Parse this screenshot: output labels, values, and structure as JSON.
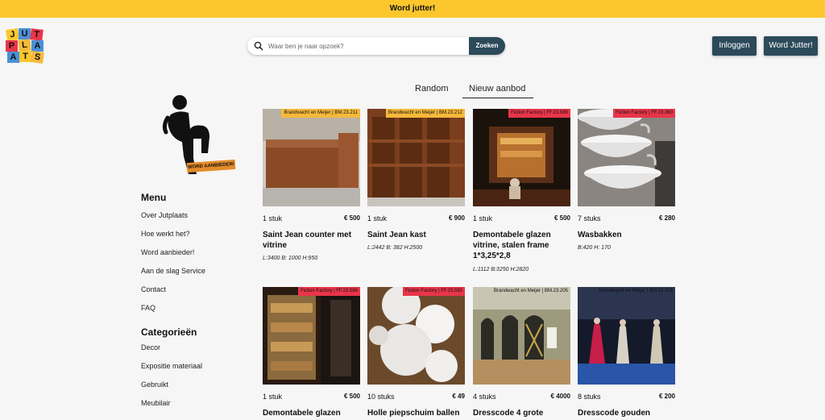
{
  "topbar": {
    "text": "Word jutter!"
  },
  "logo": {
    "letters": [
      "J",
      "U",
      "T",
      "P",
      "L",
      "A",
      "A",
      "T",
      "S"
    ]
  },
  "search": {
    "placeholder": "Waar ben je naar opzoek?",
    "button": "Zoeken"
  },
  "header_buttons": {
    "login": "Inloggen",
    "signup": "Word Jutter!"
  },
  "tabs": {
    "random": "Random",
    "new": "Nieuw aanbod",
    "active": "Nieuw aanbod"
  },
  "badge": {
    "text": "WORD AANBIEDER!"
  },
  "sidebar": {
    "menu_heading": "Menu",
    "menu_items": [
      "Over Jutplaats",
      "Hoe werkt het?",
      "Word aanbieder!",
      "Aan de slag Service",
      "Contact",
      "FAQ"
    ],
    "categories_heading": "Categorieën",
    "category_items": [
      "Decor",
      "Expositie materiaal",
      "Gebruikt",
      "Meubilair"
    ]
  },
  "colors": {
    "accent": "#fcc72c",
    "primary": "#2c4a5a",
    "tag_red": "#e8354a",
    "tag_yellow": "#f6b93b"
  },
  "products": [
    {
      "supplier": "Brandwacht en Meijer",
      "code": "BM.23.211",
      "tag_color": "yellow",
      "qty": "1 stuk",
      "price": "€ 500",
      "title": "Saint Jean counter met vitrine",
      "dims": "L:3400  B: 1000  H:950"
    },
    {
      "supplier": "Brandwacht en Meijer",
      "code": "BM.23.212",
      "tag_color": "yellow",
      "qty": "1 stuk",
      "price": "€ 900",
      "title": "Saint Jean kast",
      "dims": "L:2442  B: 382  H:2500"
    },
    {
      "supplier": "Fiction Factory",
      "code": "FF.23.589",
      "tag_color": "red",
      "qty": "1 stuk",
      "price": "€ 500",
      "title": "Demontabele glazen vitrine, stalen frame 1*3,25*2,8",
      "dims": "L:1112  B:3250  H:2820"
    },
    {
      "supplier": "Fiction Factory",
      "code": "FF.23.360",
      "tag_color": "red",
      "qty": "7 stuks",
      "price": "€ 280",
      "title": "Wasbakken",
      "dims": "B:420  H: 170"
    },
    {
      "supplier": "Fiction Factory",
      "code": "FF.23.588",
      "tag_color": "red",
      "qty": "1 stuk",
      "price": "€ 500",
      "title": "Demontabele glazen",
      "dims": ""
    },
    {
      "supplier": "Fiction Factory",
      "code": "FF.23.592",
      "tag_color": "red",
      "qty": "10 stuks",
      "price": "€ 49",
      "title": "Holle piepschuim ballen",
      "dims": ""
    },
    {
      "supplier": "Brandwacht en Meijer",
      "code": "BM.23.205",
      "tag_color": "none",
      "qty": "4 stuks",
      "price": "€ 4000",
      "title": "Dresscode 4 grote",
      "dims": ""
    },
    {
      "supplier": "Brandwacht en Meijer",
      "code": "BM.23.208",
      "tag_color": "none",
      "qty": "8 stuks",
      "price": "€ 200",
      "title": "Dresscode gouden",
      "dims": ""
    }
  ]
}
